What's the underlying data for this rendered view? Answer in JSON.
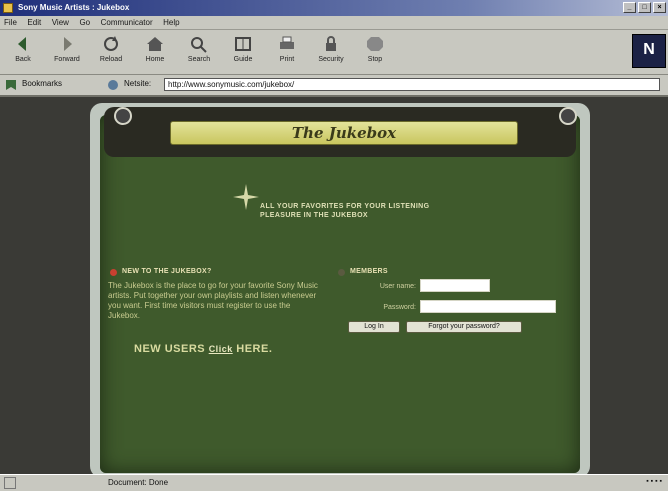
{
  "window": {
    "title": "Sony Music Artists : Jukebox"
  },
  "menu": [
    "File",
    "Edit",
    "View",
    "Go",
    "Communicator",
    "Help"
  ],
  "toolbar": [
    {
      "label": "Back",
      "icon": "back-arrow-icon"
    },
    {
      "label": "Forward",
      "icon": "forward-arrow-icon"
    },
    {
      "label": "Reload",
      "icon": "reload-icon"
    },
    {
      "label": "Home",
      "icon": "home-icon"
    },
    {
      "label": "Search",
      "icon": "search-icon"
    },
    {
      "label": "Guide",
      "icon": "guide-icon"
    },
    {
      "label": "Print",
      "icon": "print-icon"
    },
    {
      "label": "Security",
      "icon": "security-icon"
    },
    {
      "label": "Stop",
      "icon": "stop-icon"
    }
  ],
  "brand": "N",
  "location": {
    "bookmarks_label": "Bookmarks",
    "location_label": "Netsite:",
    "url": "http://www.sonymusic.com/jukebox/"
  },
  "page": {
    "banner": "The Jukebox",
    "invite": "ALL YOUR FAVORITES FOR YOUR LISTENING PLEASURE IN THE JUKEBOX",
    "left_heading": "NEW TO THE JUKEBOX?",
    "left_body": "The Jukebox is the place to go for your favorite Sony Music artists. Put together your own playlists and listen whenever you want. First time visitors must register to use the Jukebox.",
    "new_users": "NEW USERS",
    "new_users_link": "Click",
    "new_users_tail": "HERE.",
    "right_heading": "MEMBERS",
    "username_label": "User name:",
    "password_label": "Password:",
    "login_button": "Log In",
    "forgot_button": "Forgot your password?"
  },
  "status": {
    "text": "Document: Done"
  },
  "colors": {
    "panel": "#3f5a2c",
    "banner": "#d9d78a",
    "titlebar": "#1f2f7a"
  }
}
